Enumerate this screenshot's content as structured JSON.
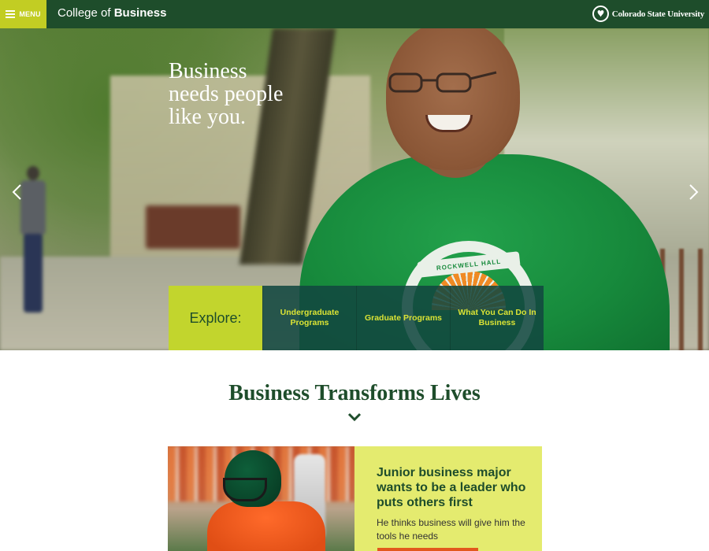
{
  "header": {
    "menu_label": "MENU",
    "site_title_prefix": "College of ",
    "site_title_bold": "Business",
    "university_name": "Colorado State University"
  },
  "hero": {
    "headline_line1": "Business",
    "headline_line2": "needs people",
    "headline_line3": "like you.",
    "shirt_logo_text": "ROCKWELL HALL"
  },
  "explore": {
    "label": "Explore:",
    "links": [
      {
        "label": "Undergraduate Programs"
      },
      {
        "label": "Graduate Programs"
      },
      {
        "label": "What You Can Do In Business"
      }
    ]
  },
  "section": {
    "title": "Business Transforms Lives"
  },
  "story": {
    "heading": "Junior business major wants to be a leader who puts others first",
    "subtext": "He thinks business will give him the tools he needs"
  },
  "colors": {
    "header_green": "#1e4d2b",
    "accent_lime": "#c2d52d",
    "story_bg": "#e4eb6f",
    "explore_link_text": "#dbe335",
    "cta_orange": "#e2581d"
  },
  "icons": [
    "hamburger-icon",
    "csu-ram-logo-icon",
    "chevron-left-icon",
    "chevron-right-icon",
    "chevron-down-icon"
  ]
}
